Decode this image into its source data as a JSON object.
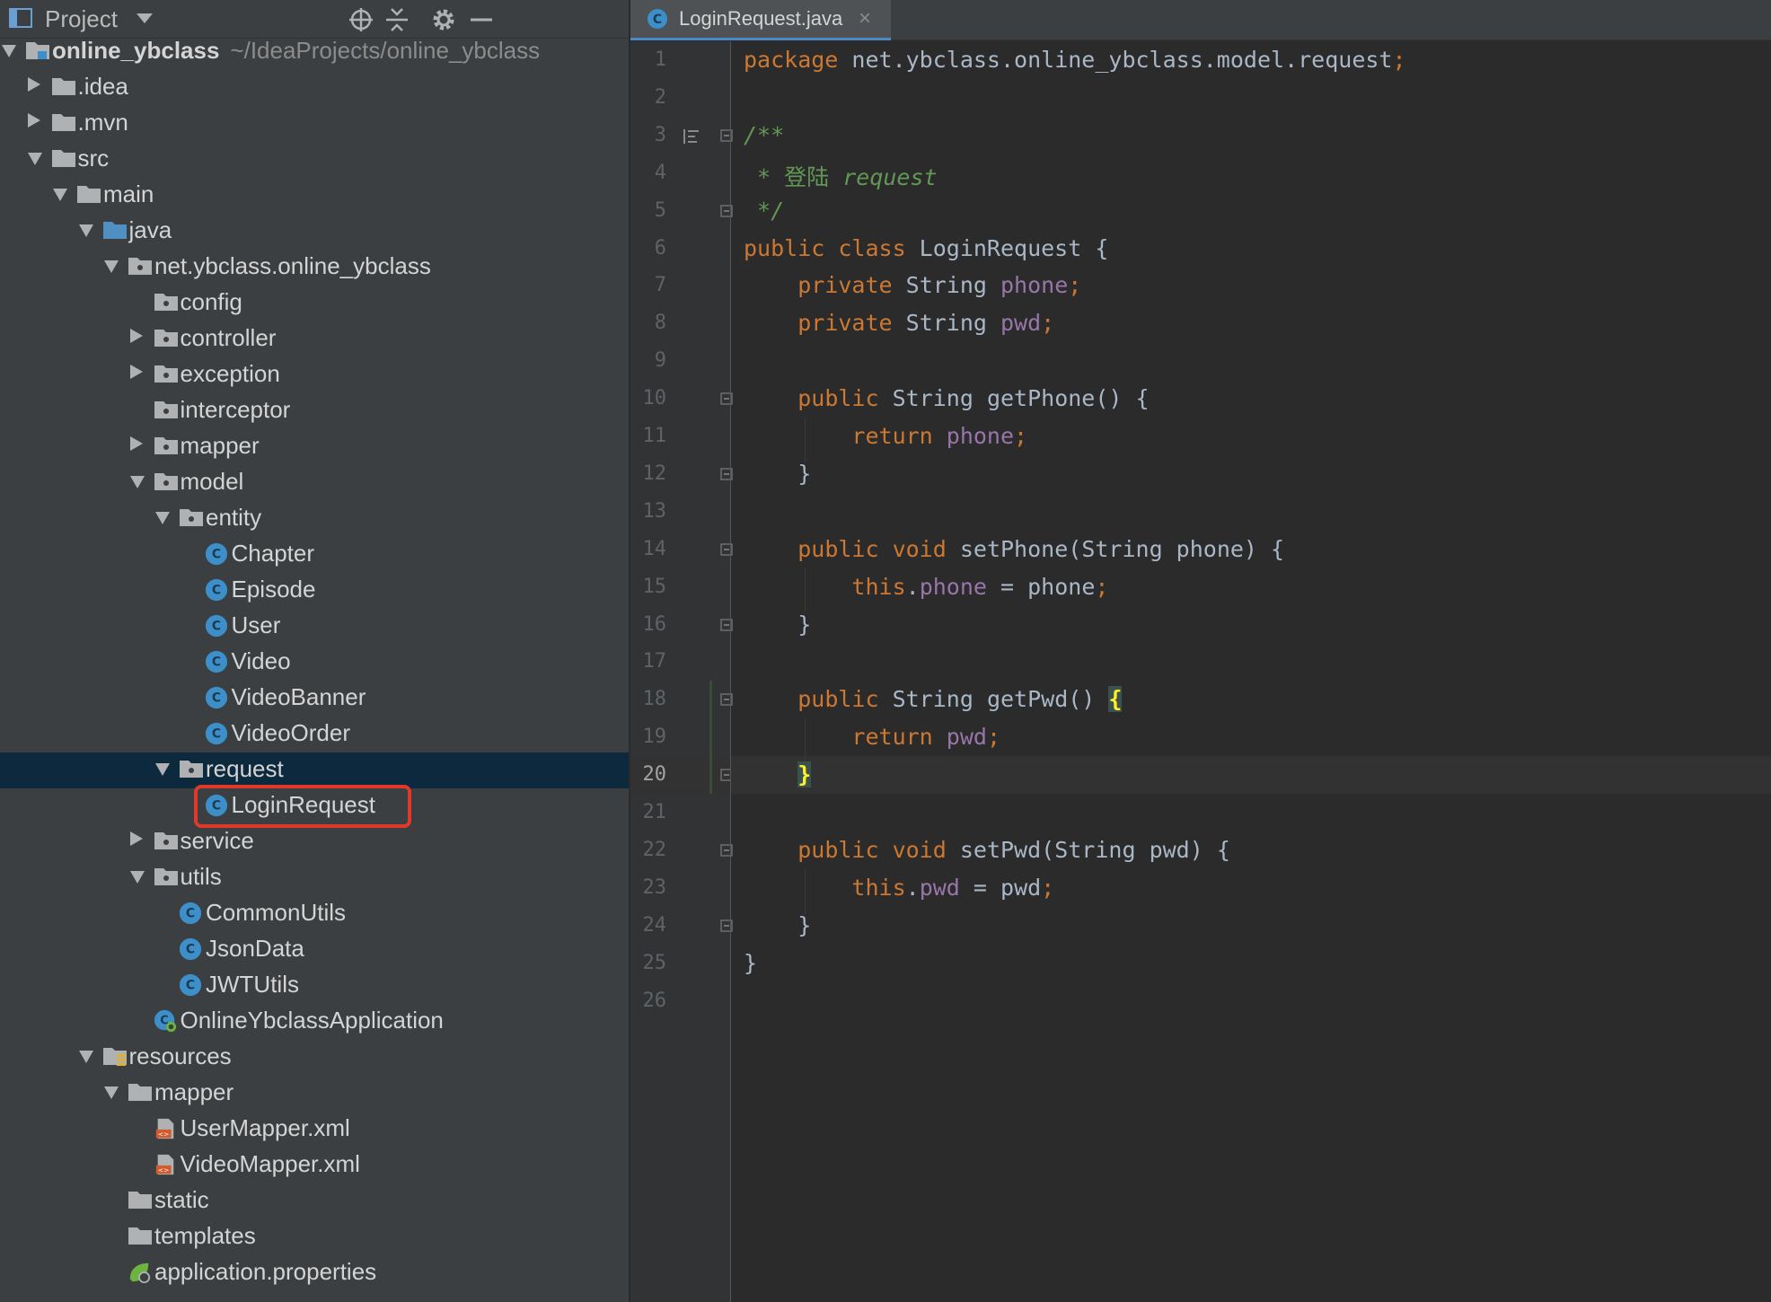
{
  "project_panel": {
    "title": "Project",
    "tree": [
      {
        "label": "online_ybclass",
        "path": "~/IdeaProjects/online_ybclass",
        "depth": 0,
        "state": "expanded",
        "icon": "module-folder-icon",
        "bold": true
      },
      {
        "label": ".idea",
        "depth": 1,
        "state": "collapsed",
        "icon": "folder-icon"
      },
      {
        "label": ".mvn",
        "depth": 1,
        "state": "collapsed",
        "icon": "folder-icon"
      },
      {
        "label": "src",
        "depth": 1,
        "state": "expanded",
        "icon": "folder-icon"
      },
      {
        "label": "main",
        "depth": 2,
        "state": "expanded",
        "icon": "folder-icon"
      },
      {
        "label": "java",
        "depth": 3,
        "state": "expanded",
        "icon": "source-folder-icon"
      },
      {
        "label": "net.ybclass.online_ybclass",
        "depth": 4,
        "state": "expanded",
        "icon": "package-icon"
      },
      {
        "label": "config",
        "depth": 5,
        "state": "none",
        "icon": "package-icon"
      },
      {
        "label": "controller",
        "depth": 5,
        "state": "collapsed",
        "icon": "package-icon"
      },
      {
        "label": "exception",
        "depth": 5,
        "state": "collapsed",
        "icon": "package-icon"
      },
      {
        "label": "interceptor",
        "depth": 5,
        "state": "none",
        "icon": "package-icon"
      },
      {
        "label": "mapper",
        "depth": 5,
        "state": "collapsed",
        "icon": "package-icon"
      },
      {
        "label": "model",
        "depth": 5,
        "state": "expanded",
        "icon": "package-icon"
      },
      {
        "label": "entity",
        "depth": 6,
        "state": "expanded",
        "icon": "package-icon"
      },
      {
        "label": "Chapter",
        "depth": 7,
        "state": "none",
        "icon": "class-icon"
      },
      {
        "label": "Episode",
        "depth": 7,
        "state": "none",
        "icon": "class-icon"
      },
      {
        "label": "User",
        "depth": 7,
        "state": "none",
        "icon": "class-icon"
      },
      {
        "label": "Video",
        "depth": 7,
        "state": "none",
        "icon": "class-icon"
      },
      {
        "label": "VideoBanner",
        "depth": 7,
        "state": "none",
        "icon": "class-icon"
      },
      {
        "label": "VideoOrder",
        "depth": 7,
        "state": "none",
        "icon": "class-icon"
      },
      {
        "label": "request",
        "depth": 6,
        "state": "expanded",
        "icon": "package-icon",
        "selected": true
      },
      {
        "label": "LoginRequest",
        "depth": 7,
        "state": "none",
        "icon": "class-icon",
        "highlighted": true
      },
      {
        "label": "service",
        "depth": 5,
        "state": "collapsed",
        "icon": "package-icon"
      },
      {
        "label": "utils",
        "depth": 5,
        "state": "expanded",
        "icon": "package-icon"
      },
      {
        "label": "CommonUtils",
        "depth": 6,
        "state": "none",
        "icon": "class-icon"
      },
      {
        "label": "JsonData",
        "depth": 6,
        "state": "none",
        "icon": "class-icon"
      },
      {
        "label": "JWTUtils",
        "depth": 6,
        "state": "none",
        "icon": "class-icon"
      },
      {
        "label": "OnlineYbclassApplication",
        "depth": 5,
        "state": "none",
        "icon": "spring-boot-class-icon"
      },
      {
        "label": "resources",
        "depth": 3,
        "state": "expanded",
        "icon": "resources-folder-icon"
      },
      {
        "label": "mapper",
        "depth": 4,
        "state": "expanded",
        "icon": "folder-icon"
      },
      {
        "label": "UserMapper.xml",
        "depth": 5,
        "state": "none",
        "icon": "xml-file-icon"
      },
      {
        "label": "VideoMapper.xml",
        "depth": 5,
        "state": "none",
        "icon": "xml-file-icon"
      },
      {
        "label": "static",
        "depth": 4,
        "state": "none",
        "icon": "folder-icon"
      },
      {
        "label": "templates",
        "depth": 4,
        "state": "none",
        "icon": "folder-icon"
      },
      {
        "label": "application.properties",
        "depth": 4,
        "state": "none",
        "icon": "spring-properties-icon"
      }
    ]
  },
  "editor": {
    "tab": {
      "label": "LoginRequest.java",
      "close": "×"
    },
    "current_line": 20,
    "lines": [
      [
        [
          "kw",
          "package "
        ],
        [
          "",
          "net.ybclass.online_ybclass.model.request"
        ],
        [
          "kw",
          ";"
        ]
      ],
      [],
      [
        [
          "comment",
          "/**"
        ]
      ],
      [
        [
          "comment",
          " * "
        ],
        [
          "commentcjk",
          "登陆"
        ],
        [
          "comment",
          " request"
        ]
      ],
      [
        [
          "comment",
          " */"
        ]
      ],
      [
        [
          "kw",
          "public class "
        ],
        [
          "",
          "LoginRequest {"
        ]
      ],
      [
        [
          "",
          "    "
        ],
        [
          "kw",
          "private "
        ],
        [
          "",
          "String "
        ],
        [
          "field",
          "phone"
        ],
        [
          "kw",
          ";"
        ]
      ],
      [
        [
          "",
          "    "
        ],
        [
          "kw",
          "private "
        ],
        [
          "",
          "String "
        ],
        [
          "field",
          "pwd"
        ],
        [
          "kw",
          ";"
        ]
      ],
      [],
      [
        [
          "",
          "    "
        ],
        [
          "kw",
          "public "
        ],
        [
          "",
          "String "
        ],
        [
          "method",
          "getPhone"
        ],
        [
          "",
          "() {"
        ]
      ],
      [
        [
          "",
          "        "
        ],
        [
          "kw",
          "return "
        ],
        [
          "field",
          "phone"
        ],
        [
          "kw",
          ";"
        ]
      ],
      [
        [
          "",
          "    }"
        ]
      ],
      [],
      [
        [
          "",
          "    "
        ],
        [
          "kw",
          "public void "
        ],
        [
          "method",
          "setPhone"
        ],
        [
          "",
          "(String phone) {"
        ]
      ],
      [
        [
          "",
          "        "
        ],
        [
          "kw",
          "this"
        ],
        [
          "",
          "."
        ],
        [
          "field",
          "phone"
        ],
        [
          "",
          " = phone"
        ],
        [
          "kw",
          ";"
        ]
      ],
      [
        [
          "",
          "    }"
        ]
      ],
      [],
      [
        [
          "",
          "    "
        ],
        [
          "kw",
          "public "
        ],
        [
          "",
          "String "
        ],
        [
          "method",
          "getPwd"
        ],
        [
          "",
          "() "
        ],
        [
          "brace-match",
          "{"
        ]
      ],
      [
        [
          "",
          "        "
        ],
        [
          "kw",
          "return "
        ],
        [
          "field",
          "pwd"
        ],
        [
          "kw",
          ";"
        ]
      ],
      [
        [
          "",
          "    "
        ],
        [
          "brace-match",
          "}"
        ]
      ],
      [],
      [
        [
          "",
          "    "
        ],
        [
          "kw",
          "public void "
        ],
        [
          "method",
          "setPwd"
        ],
        [
          "",
          "(String pwd) {"
        ]
      ],
      [
        [
          "",
          "        "
        ],
        [
          "kw",
          "this"
        ],
        [
          "",
          "."
        ],
        [
          "field",
          "pwd"
        ],
        [
          "",
          " = pwd"
        ],
        [
          "kw",
          ";"
        ]
      ],
      [
        [
          "",
          "    }"
        ]
      ],
      [
        [
          "",
          "}"
        ]
      ],
      []
    ],
    "fold_lines": [
      3,
      5,
      10,
      12,
      14,
      16,
      18,
      20,
      22,
      24
    ],
    "line_numbers": [
      "1",
      "2",
      "3",
      "4",
      "5",
      "6",
      "7",
      "8",
      "9",
      "10",
      "11",
      "12",
      "13",
      "14",
      "15",
      "16",
      "17",
      "18",
      "19",
      "20",
      "21",
      "22",
      "23",
      "24",
      "25",
      "26"
    ]
  },
  "colors": {
    "panel_bg": "#3c3f41",
    "editor_bg": "#2b2b2b",
    "selection": "#0d293e",
    "highlight_box": "#e0392b",
    "keyword": "#cc7832",
    "field": "#9876aa",
    "comment": "#629755",
    "class_icon": "#3d8fc9"
  }
}
